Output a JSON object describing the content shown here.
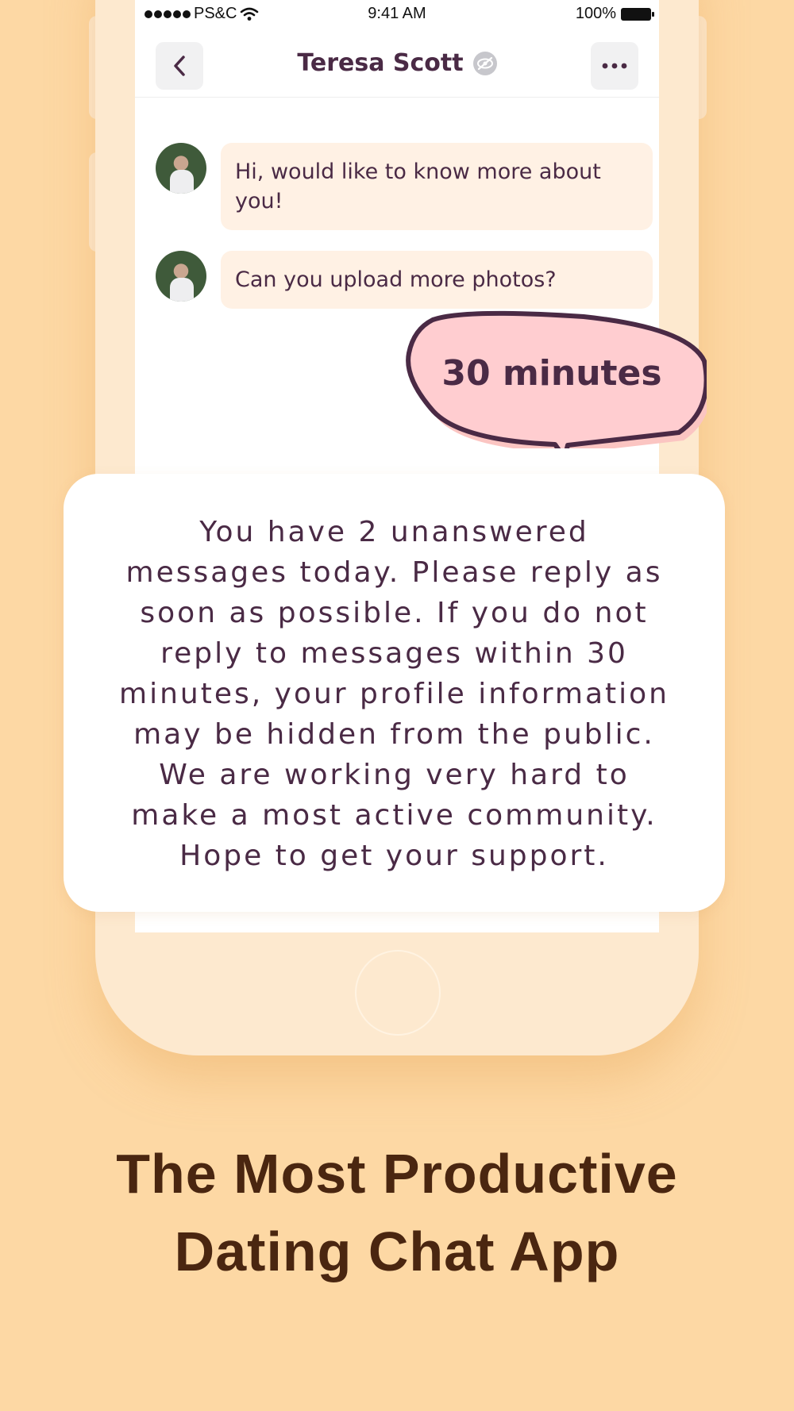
{
  "status_bar": {
    "carrier": "PS&C",
    "time": "9:41 AM",
    "battery": "100%"
  },
  "nav": {
    "title": "Teresa Scott",
    "back_icon": "chevron-left-icon",
    "more_icon": "ellipsis-icon",
    "badge_icon": "eye-slash-icon"
  },
  "messages": [
    {
      "text": "Hi, would like to know more about you!"
    },
    {
      "text": "Can you upload more photos?"
    }
  ],
  "callout": {
    "text": "30 minutes",
    "fill": "#ffcdd0",
    "stroke": "#4a2a45"
  },
  "notice": {
    "lines": [
      "You have 2 unanswered",
      "messages today. Please reply as",
      "soon as possible. If you do not",
      "reply to messages within 30",
      "minutes, your profile information",
      "may be hidden from the public.",
      "We are working very hard to",
      "make a most active community.",
      "Hope to get your support."
    ]
  },
  "headline": {
    "line1": "The Most Productive",
    "line2": "Dating Chat App"
  },
  "colors": {
    "background": "#fdd8a4",
    "phone": "#fde9cf",
    "text_dark": "#4a2a45",
    "headline": "#4a2610",
    "bubble": "#fff1e4"
  }
}
